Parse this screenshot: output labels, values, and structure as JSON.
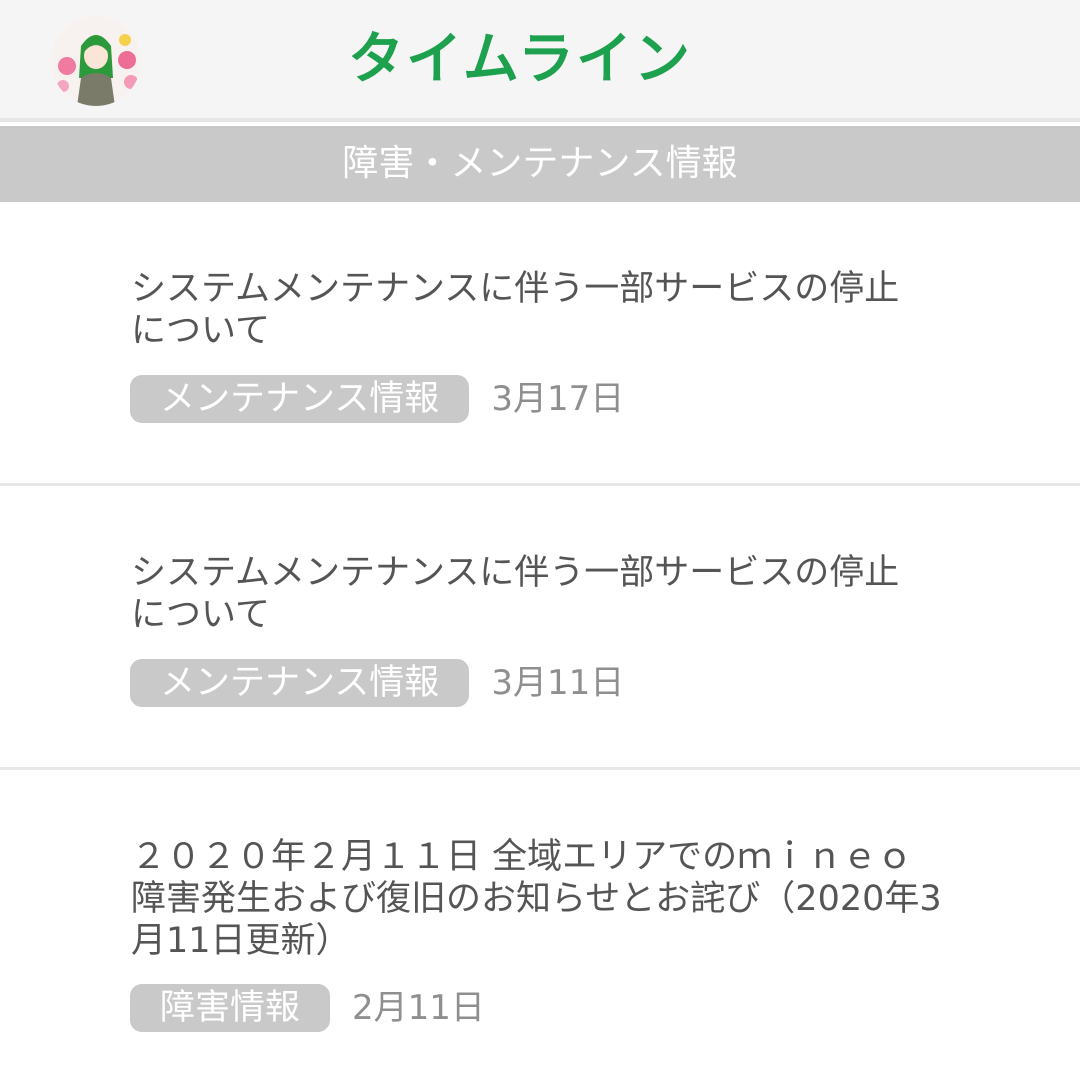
{
  "header": {
    "title": "タイムライン",
    "avatar_icon": "user-avatar-icon"
  },
  "section": {
    "label": "障害・メンテナンス情報"
  },
  "items": [
    {
      "title_lines": [
        "システムメンテナンスに伴う一部サービスの停止",
        "について"
      ],
      "tag": "メンテナンス情報",
      "date": "3月17日"
    },
    {
      "title_lines": [
        "システムメンテナンスに伴う一部サービスの停止",
        "について"
      ],
      "tag": "メンテナンス情報",
      "date": "3月11日"
    },
    {
      "title_lines": [
        "２０２０年２月１１日 全域エリアでのｍｉｎｅｏ",
        "障害発生および復旧のお知らせとお詫び（2020年3",
        "月11日更新）"
      ],
      "tag": "障害情報",
      "date": "2月11日"
    }
  ],
  "colors": {
    "accent": "#1da14f",
    "bar": "#c9c9c9",
    "text": "#555555",
    "date": "#8f8f8f"
  }
}
